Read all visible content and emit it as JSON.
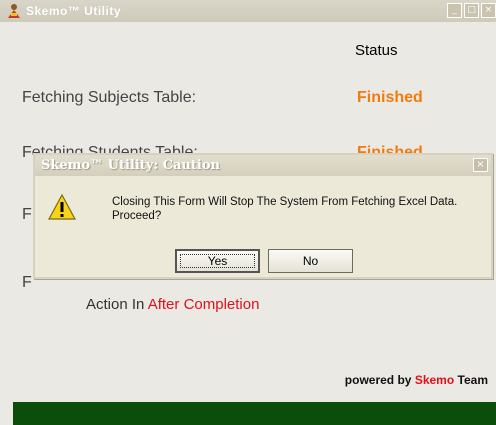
{
  "window": {
    "title": "Skemo™ Utility",
    "controls": [
      "minimize",
      "maximize",
      "close"
    ]
  },
  "status_header": "Status",
  "rows": [
    {
      "label": "Fetching Subjects Table:",
      "status": "Finished"
    },
    {
      "label": "Fetching Students Table:",
      "status": "Finished"
    },
    {
      "label": "F"
    },
    {
      "label": "F"
    }
  ],
  "action": {
    "prefix": "Action In",
    "value": "After Completion"
  },
  "powered": {
    "prefix": "powered  by",
    "brand": "Skemo",
    "suffix": "Team"
  },
  "dialog": {
    "title": "Skemo™ Utility: Caution",
    "message": "Closing This Form Will Stop The System From Fetching Excel Data. Proceed?",
    "yes_label": "Yes",
    "no_label": "No",
    "icon": "warning-icon"
  },
  "colors": {
    "status_finished": "#f07c10",
    "accent_red": "#e0101a",
    "footer_green": "#0b4d0b"
  }
}
